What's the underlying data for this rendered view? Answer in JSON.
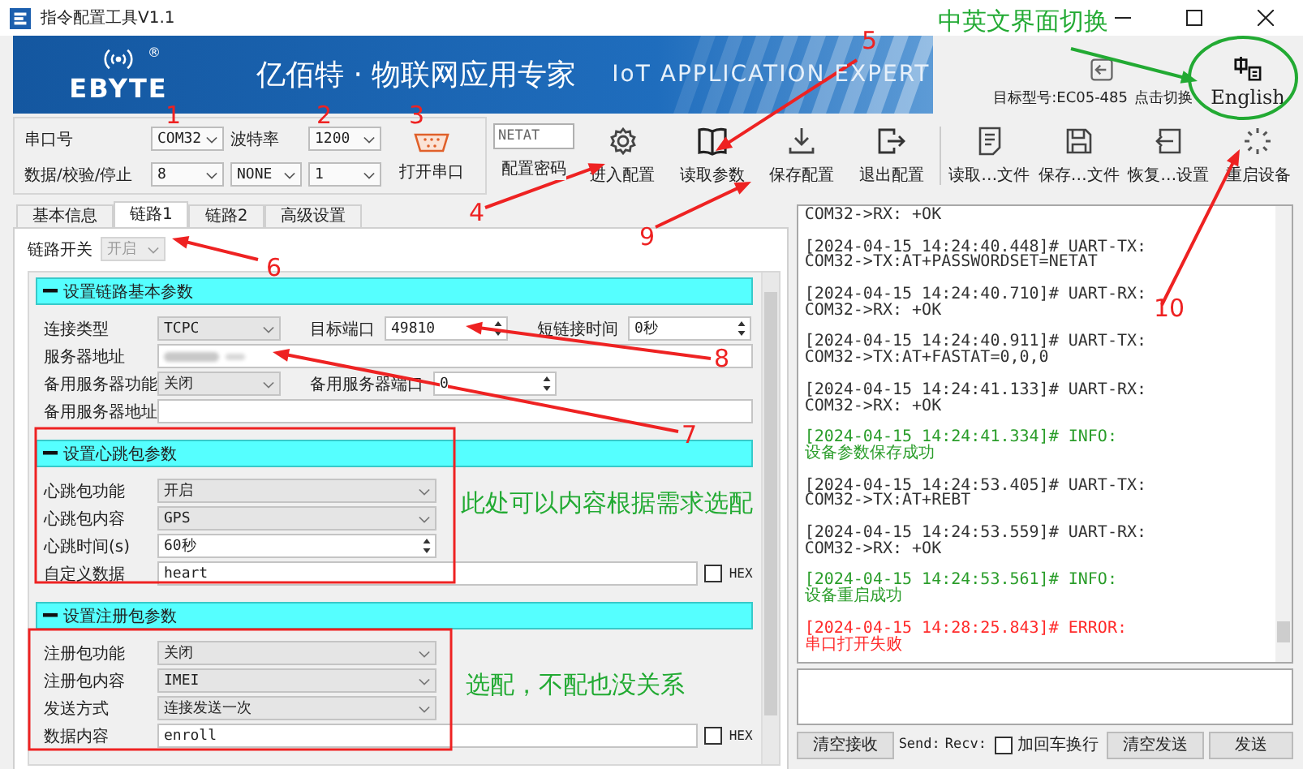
{
  "window": {
    "title": "指令配置工具V1.1"
  },
  "banner": {
    "registered_mark": "®",
    "brand": "EBYTE",
    "slogan": "亿佰特 · 物联网应用专家",
    "tagline": "IoT APPLICATION EXPERT",
    "model_label": "目标型号:EC05-485",
    "switch_link": "点击切换",
    "language_button": "English"
  },
  "serial": {
    "port_label": "串口号",
    "port": "COM32",
    "baud_label": "波特率",
    "baud": "1200",
    "format_label": "数据/校验/停止",
    "data_bits": "8",
    "parity": "NONE",
    "stop_bits": "1",
    "open_button": "打开串口"
  },
  "password": {
    "value": "NETAT",
    "label": "配置密码"
  },
  "config_buttons": [
    {
      "label": "进入配置",
      "kind": "gear"
    },
    {
      "label": "读取参数",
      "kind": "book"
    },
    {
      "label": "保存配置",
      "kind": "download"
    },
    {
      "label": "退出配置",
      "kind": "exit"
    }
  ],
  "file_buttons": [
    {
      "label": "读取…文件",
      "kind": "document"
    },
    {
      "label": "保存…文件",
      "kind": "floppy"
    },
    {
      "label": "恢复…设置",
      "kind": "restore"
    },
    {
      "label": "重启设备",
      "kind": "spinner"
    }
  ],
  "tabs": [
    {
      "label": "基本信息",
      "selected": false
    },
    {
      "label": "链路1",
      "selected": true
    },
    {
      "label": "链路2",
      "selected": false
    },
    {
      "label": "高级设置",
      "selected": false
    }
  ],
  "link_switch": {
    "label": "链路开关",
    "value": "开启",
    "disabled": true
  },
  "sections": [
    {
      "title": "设置链路基本参数",
      "rows": [
        {
          "fields": [
            {
              "label": "连接类型",
              "kind": "select",
              "value": "TCPC"
            },
            {
              "label": "目标端口",
              "kind": "spin",
              "value": "49810"
            },
            {
              "label": "短链接时间",
              "kind": "spin",
              "value": "0秒"
            }
          ]
        },
        {
          "fields": [
            {
              "label": "服务器地址",
              "kind": "masked"
            }
          ]
        },
        {
          "fields": [
            {
              "label": "备用服务器功能",
              "kind": "select",
              "value": "关闭"
            },
            {
              "label": "备用服务器端口",
              "kind": "spin",
              "value": "0"
            }
          ]
        },
        {
          "fields": [
            {
              "label": "备用服务器地址",
              "kind": "text"
            }
          ]
        }
      ]
    },
    {
      "title": "设置心跳包参数",
      "rows": [
        {
          "fields": [
            {
              "label": "心跳包功能",
              "kind": "select",
              "value": "开启"
            }
          ]
        },
        {
          "fields": [
            {
              "label": "心跳包内容",
              "kind": "select",
              "value": "GPS"
            }
          ]
        },
        {
          "fields": [
            {
              "label": "心跳时间(s)",
              "kind": "spin",
              "value": "60秒"
            }
          ]
        },
        {
          "fields": [
            {
              "label": "自定义数据",
              "kind": "text",
              "value": "heart",
              "hex": {
                "label": "HEX",
                "checked": false
              }
            }
          ]
        }
      ]
    },
    {
      "title": "设置注册包参数",
      "rows": [
        {
          "fields": [
            {
              "label": "注册包功能",
              "kind": "select",
              "value": "关闭"
            }
          ]
        },
        {
          "fields": [
            {
              "label": "注册包内容",
              "kind": "select",
              "value": "IMEI"
            }
          ]
        },
        {
          "fields": [
            {
              "label": "发送方式",
              "kind": "select",
              "value": "连接发送一次"
            }
          ]
        },
        {
          "fields": [
            {
              "label": "数据内容",
              "kind": "text",
              "value": "enroll",
              "hex": {
                "label": "HEX",
                "checked": false
              }
            }
          ]
        }
      ]
    }
  ],
  "log": [
    {
      "kind": "uart",
      "body": "COM32->RX: +OK"
    },
    {
      "kind": "uart",
      "header": "[2024-04-15 14:24:40.448]# UART-TX:",
      "body": "COM32->TX:AT+PASSWORDSET=NETAT"
    },
    {
      "kind": "uart",
      "header": "[2024-04-15 14:24:40.710]# UART-RX:",
      "body": "COM32->RX: +OK"
    },
    {
      "kind": "uart",
      "header": "[2024-04-15 14:24:40.911]# UART-TX:",
      "body": "COM32->TX:AT+FASTAT=0,0,0"
    },
    {
      "kind": "uart",
      "header": "[2024-04-15 14:24:41.133]# UART-RX:",
      "body": "COM32->RX: +OK"
    },
    {
      "kind": "info",
      "header": "[2024-04-15 14:24:41.334]# INFO:",
      "body": "设备参数保存成功"
    },
    {
      "kind": "uart",
      "header": "[2024-04-15 14:24:53.405]# UART-TX:",
      "body": "COM32->TX:AT+REBT"
    },
    {
      "kind": "uart",
      "header": "[2024-04-15 14:24:53.559]# UART-RX:",
      "body": "COM32->RX: +OK"
    },
    {
      "kind": "info",
      "header": "[2024-04-15 14:24:53.561]# INFO:",
      "body": "设备重启成功"
    },
    {
      "kind": "error",
      "header": "[2024-04-15 14:28:25.843]# ERROR:",
      "body": "串口打开失败"
    }
  ],
  "send_bar": {
    "clear_receive": "清空接收",
    "send_label": "Send:",
    "recv_label": "Recv:",
    "newline": {
      "label": "加回车换行",
      "checked": false
    },
    "clear_send": "清空发送",
    "send": "发送"
  },
  "annotations": {
    "numbers": [
      "1",
      "2",
      "3",
      "4",
      "5",
      "6",
      "7",
      "8",
      "9",
      "10"
    ],
    "notes": [
      "中英文界面切换",
      "此处可以内容根据需求选配",
      "选配，不配也没关系"
    ]
  }
}
